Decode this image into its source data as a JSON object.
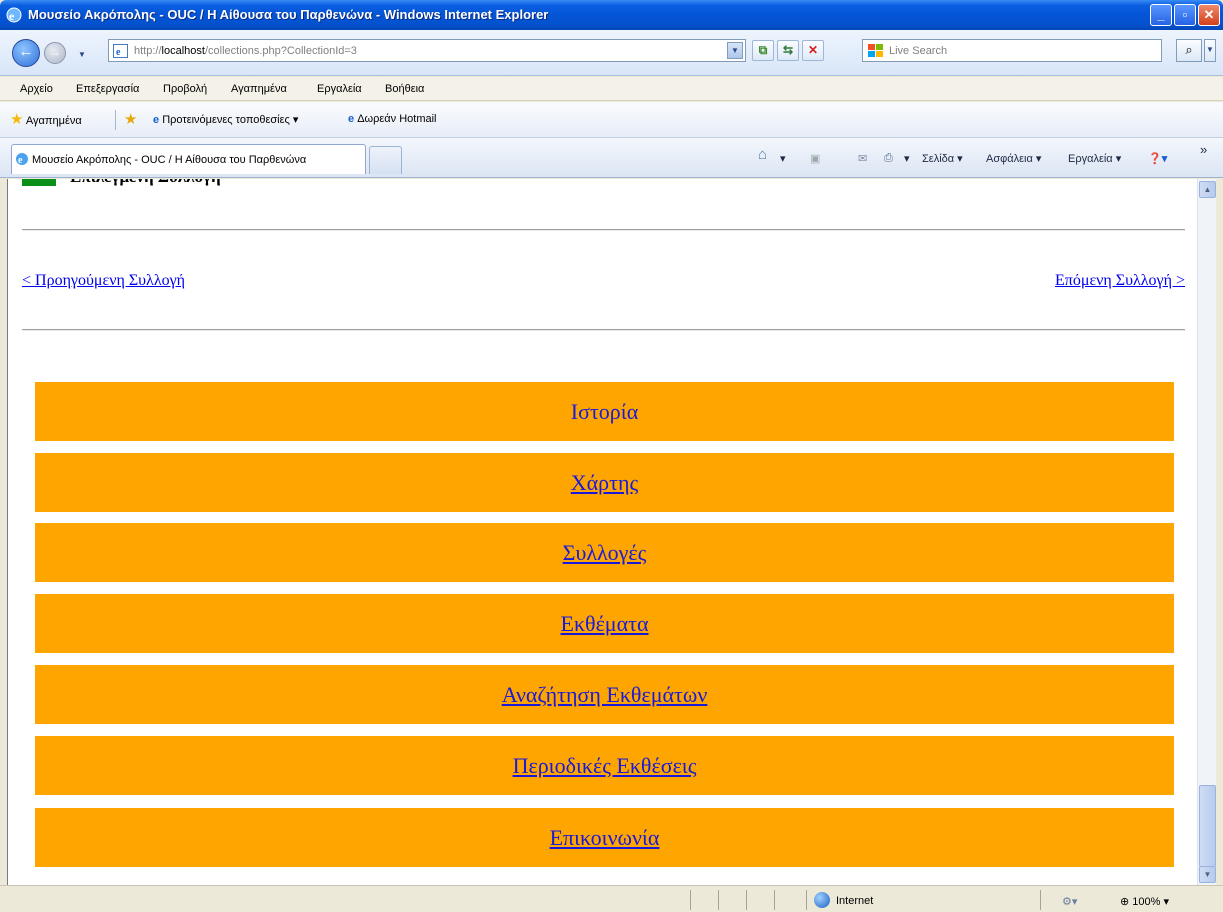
{
  "window": {
    "title": "Μουσείο Ακρόπολης - OUC / Η Αίθουσα του Παρθενώνα - Windows Internet Explorer",
    "minimize": "_",
    "maximize": "▫",
    "close": "✕"
  },
  "address": {
    "url_prefix": "http://",
    "url_host": "localhost",
    "url_path": "/collections.php?CollectionId=3",
    "search_placeholder": "Live Search"
  },
  "menu": [
    "Αρχείο",
    "Επεξεργασία",
    "Προβολή",
    "Αγαπημένα",
    "Εργαλεία",
    "Βοήθεια"
  ],
  "favorites": {
    "label": "Αγαπημένα",
    "suggested": "Προτεινόμενες τοποθεσίες ▾",
    "hotmail": "Δωρεάν Hotmail"
  },
  "tab": {
    "label": "Μουσείο Ακρόπολης - OUC / Η Αίθουσα του Παρθενώνα"
  },
  "commandbar": {
    "page": "Σελίδα ▾",
    "safety": "Ασφάλεια ▾",
    "tools": "Εργαλεία ▾",
    "more": "»"
  },
  "page": {
    "heading": "Επιλεγμένη Συλλογή",
    "prev_link": "< Προηγούμενη Συλλογή",
    "next_link": "Επόμενη Συλλογή >",
    "menu_buttons": [
      {
        "label": "Ιστορία"
      },
      {
        "label": "Χάρτης"
      },
      {
        "label": "Συλλογές"
      },
      {
        "label": "Εκθέματα"
      },
      {
        "label": "Αναζήτηση Εκθεμάτων"
      },
      {
        "label": "Περιοδικές Εκθέσεις"
      },
      {
        "label": "Επικοινωνία"
      }
    ]
  },
  "status": {
    "zone": "Internet",
    "zoom": "100%"
  },
  "colors": {
    "menu_button_bg": "#ffa500",
    "link": "#1a1ad8",
    "heading_box": "#0a8f18"
  }
}
